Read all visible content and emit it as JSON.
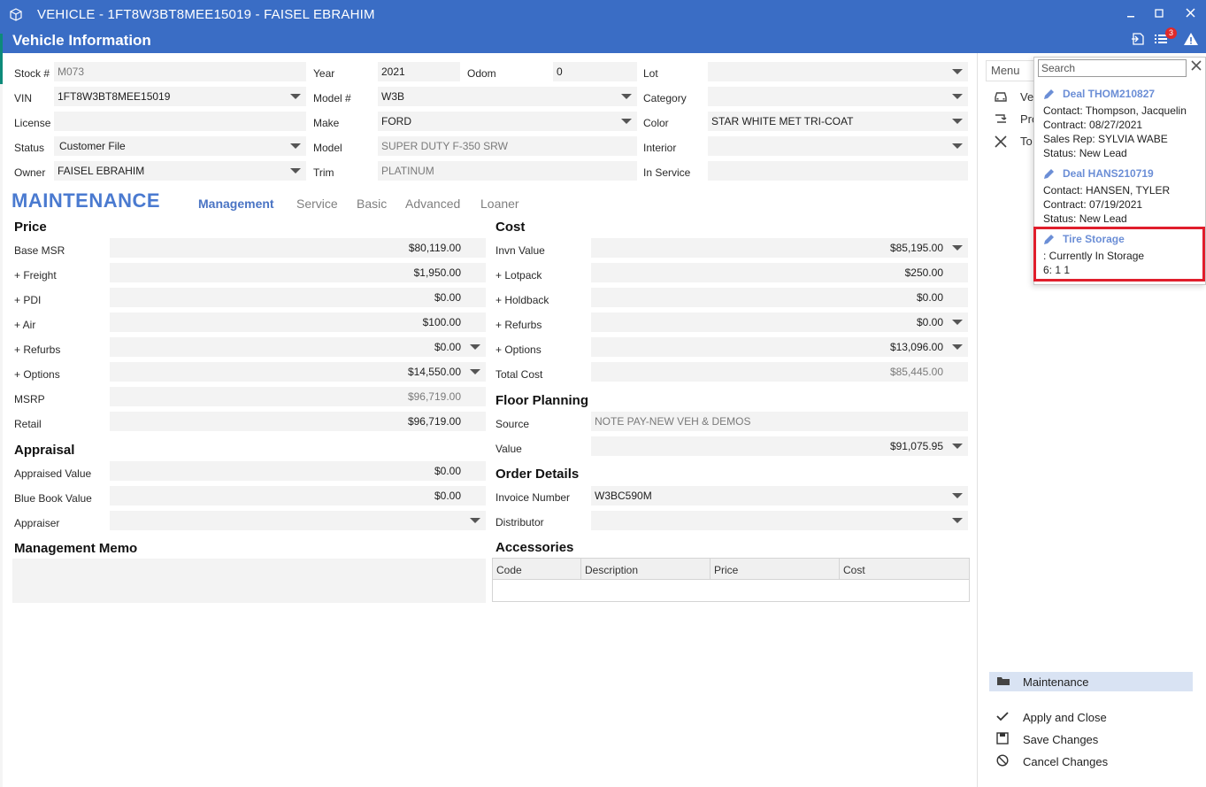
{
  "window": {
    "title": "VEHICLE - 1FT8W3BT8MEE15019 - FAISEL EBRAHIM",
    "subtitle": "Vehicle Information",
    "notification_count": "3"
  },
  "vehicle": {
    "stock_label": "Stock #",
    "stock": "M073",
    "vin_label": "VIN",
    "vin": "1FT8W3BT8MEE15019",
    "license_label": "License",
    "license": "",
    "status_label": "Status",
    "status": "Customer File",
    "owner_label": "Owner",
    "owner": "FAISEL EBRAHIM",
    "year_label": "Year",
    "year": "2021",
    "odom_label": "Odom",
    "odom": "0",
    "model_num_label": "Model #",
    "model_num": "W3B",
    "make_label": "Make",
    "make": "FORD",
    "model_label": "Model",
    "model": "SUPER DUTY F-350 SRW",
    "trim_label": "Trim",
    "trim": "PLATINUM",
    "lot_label": "Lot",
    "lot": "",
    "category_label": "Category",
    "category": "",
    "color_label": "Color",
    "color": "STAR WHITE MET TRI-COAT",
    "interior_label": "Interior",
    "interior": "",
    "in_service_label": "In Service",
    "in_service": ""
  },
  "maintenance": {
    "title": "MAINTENANCE",
    "tabs": [
      "Management",
      "Service",
      "Basic",
      "Advanced",
      "Loaner"
    ],
    "active_tab": "Management"
  },
  "price": {
    "title": "Price",
    "rows": [
      {
        "label": "Base MSR",
        "value": "$80,119.00"
      },
      {
        "label": "+  Freight",
        "value": "$1,950.00"
      },
      {
        "label": "+  PDI",
        "value": "$0.00"
      },
      {
        "label": "+  Air",
        "value": "$100.00"
      },
      {
        "label": "+ Refurbs",
        "value": "$0.00"
      },
      {
        "label": "+ Options",
        "value": "$14,550.00"
      },
      {
        "label": "MSRP",
        "value": "$96,719.00"
      },
      {
        "label": "Retail",
        "value": "$96,719.00"
      }
    ]
  },
  "appraisal": {
    "title": "Appraisal",
    "rows": [
      {
        "label": "Appraised Value",
        "value": "$0.00"
      },
      {
        "label": "Blue Book Value",
        "value": "$0.00"
      },
      {
        "label": "Appraiser",
        "value": ""
      }
    ]
  },
  "memo": {
    "title": "Management Memo",
    "text": ""
  },
  "cost": {
    "title": "Cost",
    "rows": [
      {
        "label": "Invn Value",
        "value": "$85,195.00"
      },
      {
        "label": "+ Lotpack",
        "value": "$250.00"
      },
      {
        "label": "+ Holdback",
        "value": "$0.00"
      },
      {
        "label": "+ Refurbs",
        "value": "$0.00"
      },
      {
        "label": "+ Options",
        "value": "$13,096.00"
      },
      {
        "label": "Total Cost",
        "value": "$85,445.00"
      }
    ]
  },
  "floor_planning": {
    "title": "Floor Planning",
    "source_label": "Source",
    "source": "NOTE PAY-NEW VEH & DEMOS",
    "value_label": "Value",
    "value": "$91,075.95"
  },
  "order_details": {
    "title": "Order Details",
    "invoice_label": "Invoice Number",
    "invoice": "W3BC590M",
    "distributor_label": "Distributor",
    "distributor": ""
  },
  "accessories": {
    "title": "Accessories",
    "columns": [
      "Code",
      "Description",
      "Price",
      "Cost"
    ]
  },
  "side_panel": {
    "menu_label": "Menu",
    "items": [
      "Ve",
      "Pro",
      "To"
    ],
    "maintenance_label": "Maintenance",
    "actions": [
      "Apply and Close",
      "Save Changes",
      "Cancel Changes"
    ]
  },
  "popup": {
    "search_placeholder": "Search",
    "deals": [
      {
        "title": "Deal THOM210827",
        "lines": [
          "Contact: Thompson, Jacquelin",
          "Contract: 08/27/2021",
          "Sales Rep: SYLVIA WABE",
          "Status: New Lead"
        ]
      },
      {
        "title": "Deal HANS210719",
        "lines": [
          "Contact: HANSEN, TYLER",
          "Contract: 07/19/2021",
          "Status: New Lead"
        ]
      },
      {
        "title": "Tire Storage",
        "lines": [
          ": Currently In Storage",
          "6: 1 1"
        ]
      }
    ]
  }
}
